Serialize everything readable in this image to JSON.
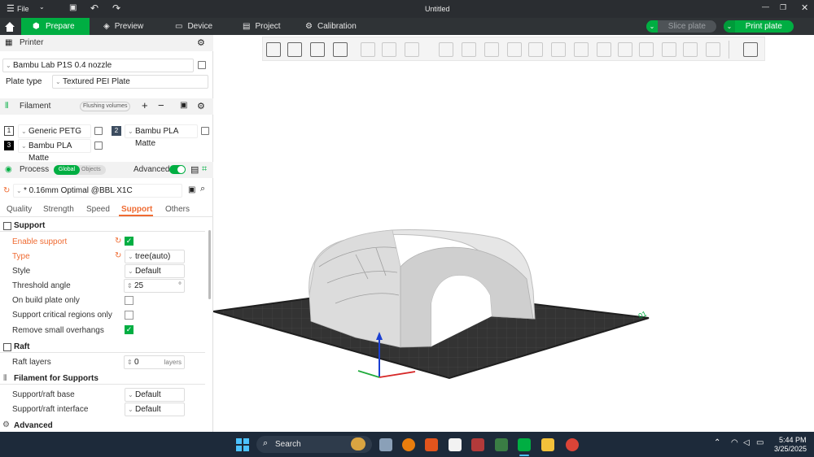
{
  "titlebar": {
    "file_label": "File",
    "doc_title": "Untitled"
  },
  "mainbar": {
    "tabs": [
      {
        "label": "Prepare"
      },
      {
        "label": "Preview"
      },
      {
        "label": "Device"
      },
      {
        "label": "Project"
      },
      {
        "label": "Calibration"
      }
    ],
    "slice_label": "Slice plate",
    "print_label": "Print plate"
  },
  "printer": {
    "section": "Printer",
    "name": "Bambu Lab P1S 0.4 nozzle",
    "plate_type_label": "Plate type",
    "plate_type": "Textured PEI Plate"
  },
  "filament": {
    "section": "Filament",
    "flushing_label": "Flushing volumes",
    "items": [
      {
        "num": "1",
        "name": "Generic PETG",
        "color": "#ffffff"
      },
      {
        "num": "2",
        "name": "Bambu PLA Matte",
        "color": "#3d4d60"
      },
      {
        "num": "3",
        "name": "Bambu PLA Matte",
        "color": "#000000"
      }
    ]
  },
  "process": {
    "section": "Process",
    "global_label": "Global",
    "objects_label": "Objects",
    "advanced_label": "Advanced",
    "profile": "* 0.16mm Optimal @BBL X1C",
    "tabs": [
      "Quality",
      "Strength",
      "Speed",
      "Support",
      "Others"
    ],
    "active_tab": "Support"
  },
  "support": {
    "group": "Support",
    "enable_label": "Enable support",
    "enable_checked": true,
    "type_label": "Type",
    "type_value": "tree(auto)",
    "style_label": "Style",
    "style_value": "Default",
    "threshold_label": "Threshold angle",
    "threshold_value": "25",
    "threshold_unit": "°",
    "build_plate_label": "On build plate only",
    "critical_label": "Support critical regions only",
    "remove_small_label": "Remove small overhangs"
  },
  "raft": {
    "group": "Raft",
    "layers_label": "Raft layers",
    "layers_value": "0",
    "layers_unit": "layers"
  },
  "filament_supports": {
    "group": "Filament for Supports",
    "base_label": "Support/raft base",
    "base_value": "Default",
    "interface_label": "Support/raft interface",
    "interface_value": "Default"
  },
  "advanced_group": "Advanced",
  "viewport": {
    "plate_number": "01"
  },
  "taskbar": {
    "search_label": "Search",
    "time": "5:44 PM",
    "date": "3/25/2025"
  },
  "colors": {
    "accent": "#00ae42",
    "orange": "#ef6b32",
    "bar": "#2f3336",
    "taskbar": "#1d2a3a"
  }
}
